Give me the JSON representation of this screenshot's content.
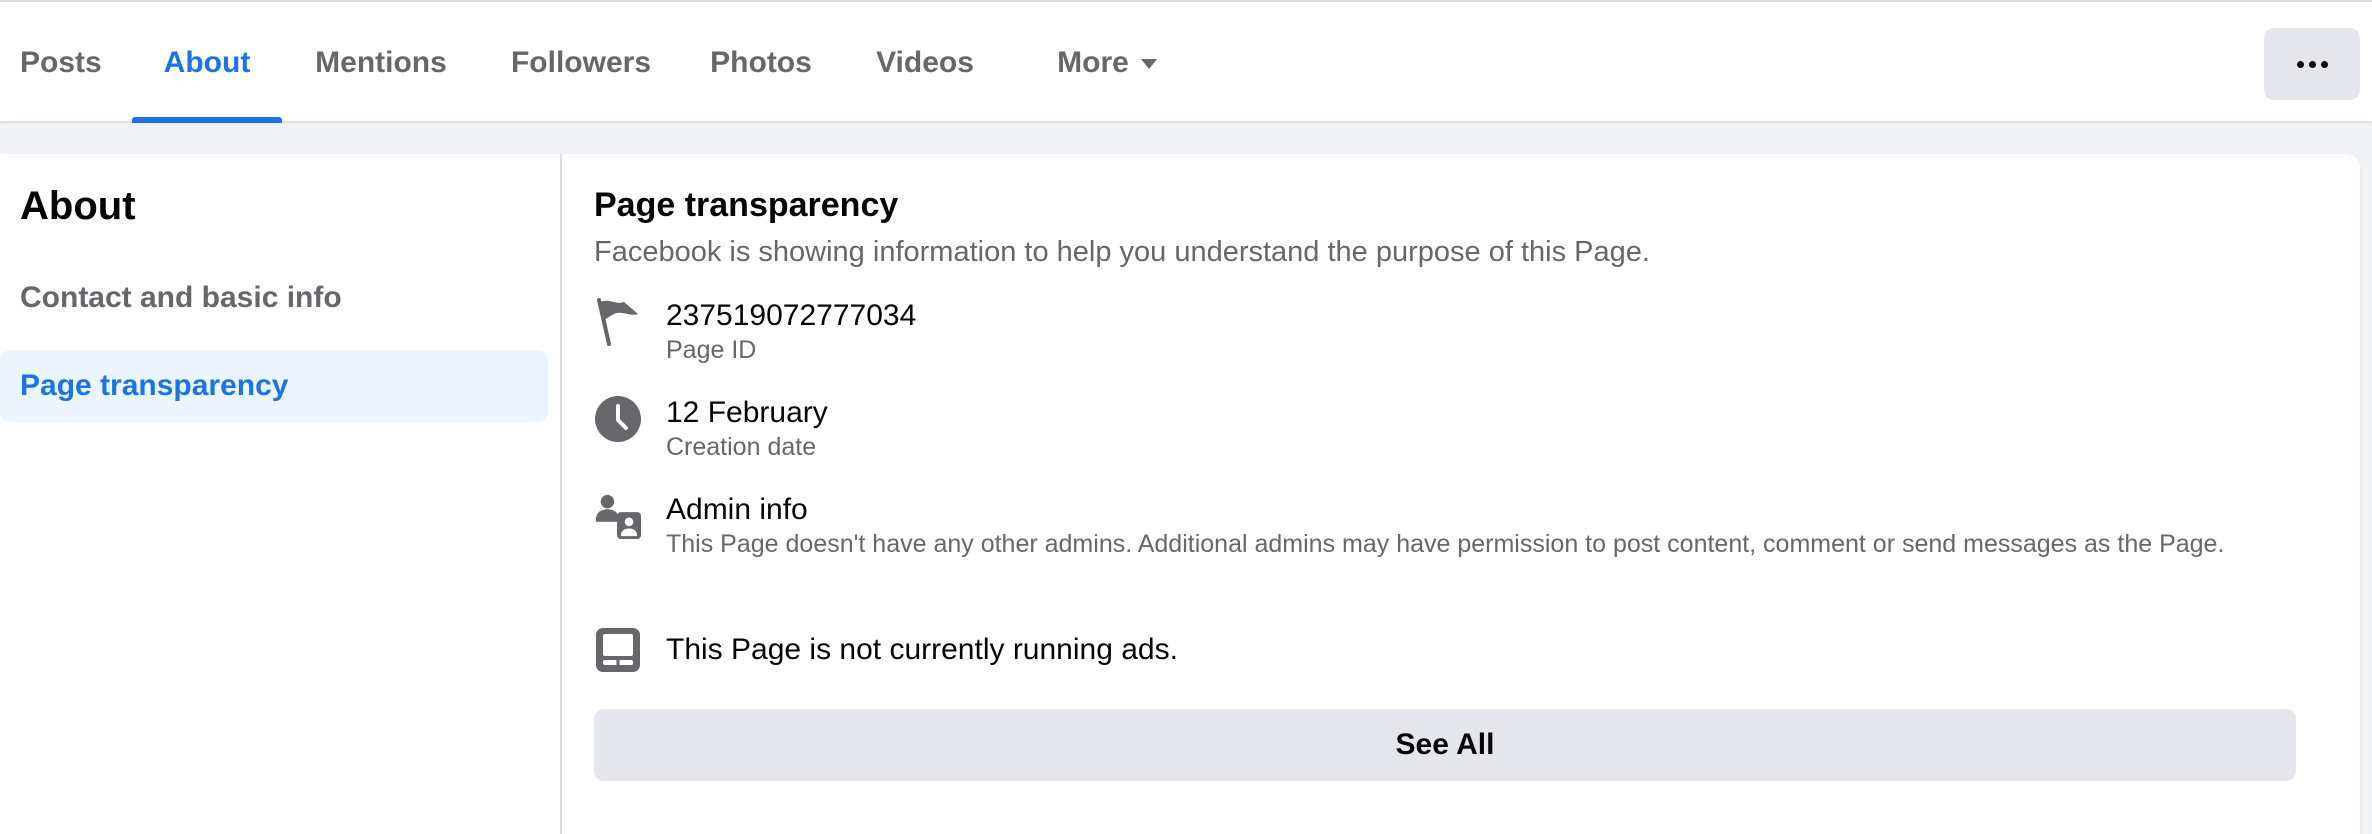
{
  "tabs": [
    {
      "label": "Posts",
      "active": false
    },
    {
      "label": "About",
      "active": true
    },
    {
      "label": "Mentions",
      "active": false
    },
    {
      "label": "Followers",
      "active": false
    },
    {
      "label": "Photos",
      "active": false
    },
    {
      "label": "Videos",
      "active": false
    },
    {
      "label": "More",
      "active": false
    }
  ],
  "overflow_icon": "more-horizontal-icon",
  "sidebar": {
    "title": "About",
    "items": [
      {
        "label": "Contact and basic info",
        "selected": false
      },
      {
        "label": "Page transparency",
        "selected": true
      }
    ]
  },
  "transparency": {
    "title": "Page transparency",
    "description": "Facebook is showing information to help you understand the purpose of this Page.",
    "rows": [
      {
        "icon": "flag-icon",
        "primary": "237519072777034",
        "secondary": "Page ID"
      },
      {
        "icon": "clock-icon",
        "primary": "12 February",
        "secondary": "Creation date"
      },
      {
        "icon": "admin-people-icon",
        "primary": "Admin info",
        "secondary": "This Page doesn't have any other admins. Additional admins may have permission to post content, comment or send messages as the Page."
      },
      {
        "icon": "ads-screen-icon",
        "primary": "This Page is not currently running ads."
      }
    ],
    "see_all_label": "See All"
  },
  "colors": {
    "accent": "#1b74e4",
    "selected_bg": "#ebf5ff",
    "secondary_text": "#65676b",
    "button_bg": "#e4e6eb",
    "page_bg": "#f0f2f5"
  }
}
